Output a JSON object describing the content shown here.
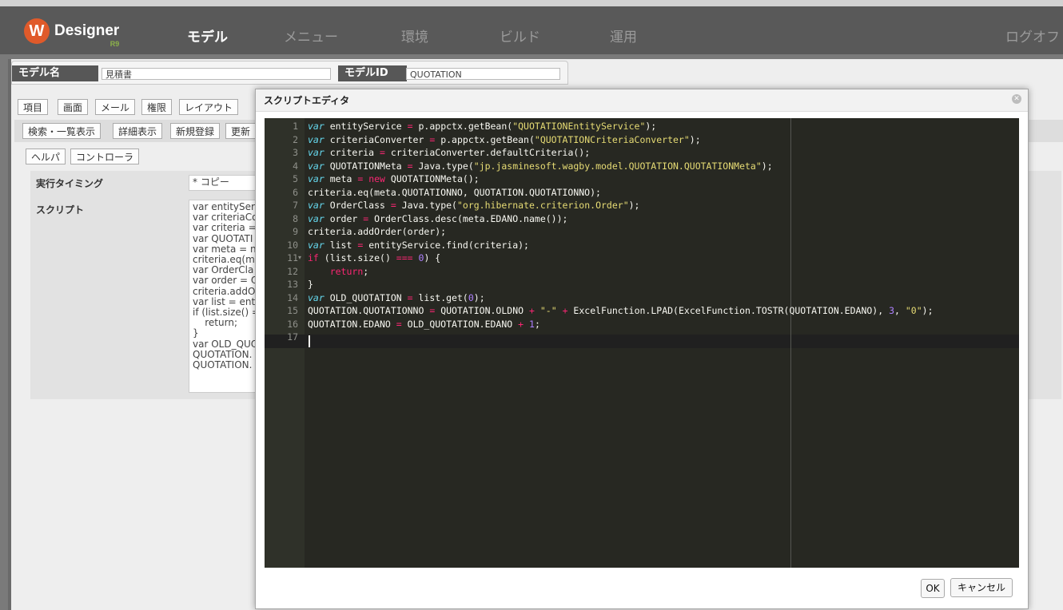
{
  "nav": {
    "logo_text": "Designer",
    "logo_version": "R9",
    "items": [
      "モデル",
      "メニュー",
      "環境",
      "ビルド",
      "運用"
    ],
    "logout": "ログオフ"
  },
  "model": {
    "name_label": "モデル名",
    "name_value": "見積書",
    "id_label": "モデルID",
    "id_value": "QUOTATION"
  },
  "main_tabs": [
    "項目",
    "画面",
    "メール",
    "権限",
    "レイアウト"
  ],
  "sub_tabs": [
    "検索・一覧表示",
    "詳細表示",
    "新規登録",
    "更新"
  ],
  "panel_tabs": [
    "ヘルパ",
    "コントローラ"
  ],
  "props": {
    "timing_label": "実行タイミング",
    "timing_value": "* コピー",
    "script_label": "スクリプト",
    "script_preview": "var entityServ\nvar criteriaCo\nvar criteria =\nvar QUOTATI\nvar meta = n\ncriteria.eq(m\nvar OrderCla\nvar order = O\ncriteria.addO\nvar list = ent\nif (list.size() =\n    return;\n}\nvar OLD_QUO\nQUOTATION.\nQUOTATION."
  },
  "dialog": {
    "title": "スクリプトエディタ",
    "ok": "OK",
    "cancel": "キャンセル",
    "lines": [
      "var entityService = p.appctx.getBean(\"QUOTATIONEntityService\");",
      "var criteriaConverter = p.appctx.getBean(\"QUOTATIONCriteriaConverter\");",
      "var criteria = criteriaConverter.defaultCriteria();",
      "var QUOTATIONMeta = Java.type(\"jp.jasminesoft.wagby.model.QUOTATION.QUOTATIONMeta\");",
      "var meta = new QUOTATIONMeta();",
      "criteria.eq(meta.QUOTATIONNO, QUOTATION.QUOTATIONNO);",
      "var OrderClass = Java.type(\"org.hibernate.criterion.Order\");",
      "var order = OrderClass.desc(meta.EDANO.name());",
      "criteria.addOrder(order);",
      "var list = entityService.find(criteria);",
      "if (list.size() === 0) {",
      "    return;",
      "}",
      "var OLD_QUOTATION = list.get(0);",
      "QUOTATION.QUOTATIONNO = QUOTATION.OLDNO + \"-\" + ExcelFunction.LPAD(ExcelFunction.TOSTR(QUOTATION.EDANO), 3, \"0\");",
      "QUOTATION.EDANO = OLD_QUOTATION.EDANO + 1;",
      ""
    ]
  },
  "colors": {
    "editor_bg": "#272822",
    "keyword": "#66d9ef",
    "operator": "#f92672",
    "string": "#e6db74",
    "number": "#ae81ff"
  }
}
